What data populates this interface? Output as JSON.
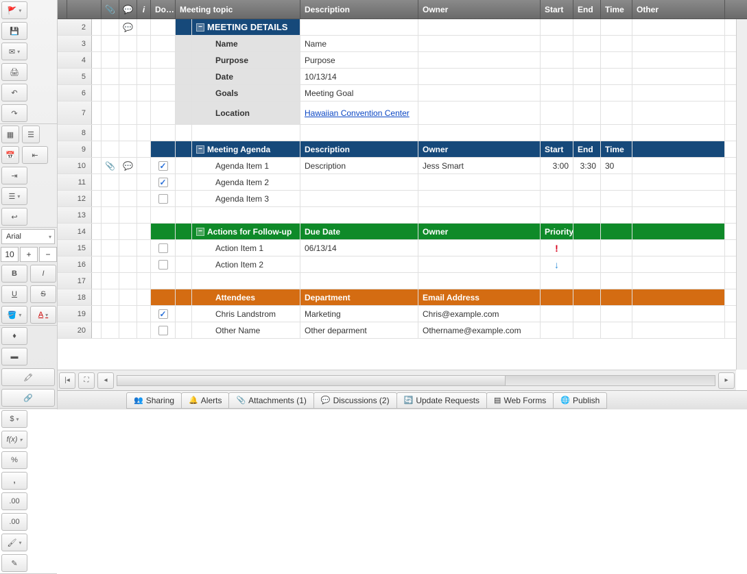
{
  "toolbar": {
    "font_family": "Arial",
    "font_size": "10",
    "buttons": {
      "bold": "B",
      "italic": "I",
      "underline": "U",
      "strike": "S",
      "currency": "$",
      "fx": "f(x)",
      "percent": "%",
      "comma": ",",
      "dec_dec": ".00",
      "dec_inc": ".00"
    }
  },
  "columns": {
    "attach": "📎",
    "comment": "💬",
    "info": "i",
    "done": "Do…",
    "topic": "Meeting topic",
    "desc": "Description",
    "owner": "Owner",
    "start": "Start",
    "end": "End",
    "time": "Time",
    "other": "Other"
  },
  "rows": {
    "2": {
      "num": "2"
    },
    "3": {
      "num": "3",
      "label": "Name",
      "value": "Name"
    },
    "4": {
      "num": "4",
      "label": "Purpose",
      "value": "Purpose"
    },
    "5": {
      "num": "5",
      "label": "Date",
      "value": "10/13/14"
    },
    "6": {
      "num": "6",
      "label": "Goals",
      "value": "Meeting Goal"
    },
    "7": {
      "num": "7",
      "label": "Location",
      "value": "Hawaiian Convention Center"
    },
    "8": {
      "num": "8"
    },
    "9": {
      "num": "9"
    },
    "10": {
      "num": "10",
      "topic": "Agenda Item 1",
      "desc": "Description",
      "owner": "Jess Smart",
      "start": "3:00",
      "end": "3:30",
      "time": "30"
    },
    "11": {
      "num": "11",
      "topic": "Agenda Item 2"
    },
    "12": {
      "num": "12",
      "topic": "Agenda Item 3"
    },
    "13": {
      "num": "13"
    },
    "14": {
      "num": "14"
    },
    "15": {
      "num": "15",
      "topic": "Action Item 1",
      "due": "06/13/14",
      "prio": "!"
    },
    "16": {
      "num": "16",
      "topic": "Action Item 2",
      "prio": "↓"
    },
    "17": {
      "num": "17"
    },
    "18": {
      "num": "18"
    },
    "19": {
      "num": "19",
      "name": "Chris Landstrom",
      "dept": "Marketing",
      "email": "Chris@example.com"
    },
    "20": {
      "num": "20",
      "name": "Other Name",
      "dept": "Other deparment",
      "email": "Othername@example.com"
    }
  },
  "sections": {
    "details": "MEETING DETAILS",
    "agenda": {
      "title": "Meeting Agenda",
      "desc": "Description",
      "owner": "Owner",
      "start": "Start",
      "end": "End",
      "time": "Time"
    },
    "actions": {
      "title": "Actions for Follow-up",
      "due": "Due Date",
      "owner": "Owner",
      "prio": "Priority"
    },
    "attendees": {
      "title": "Attendees",
      "dept": "Department",
      "email": "Email Address"
    }
  },
  "tabs": {
    "sharing": "Sharing",
    "alerts": "Alerts",
    "attachments": "Attachments (1)",
    "discussions": "Discussions (2)",
    "updates": "Update Requests",
    "webforms": "Web Forms",
    "publish": "Publish"
  }
}
